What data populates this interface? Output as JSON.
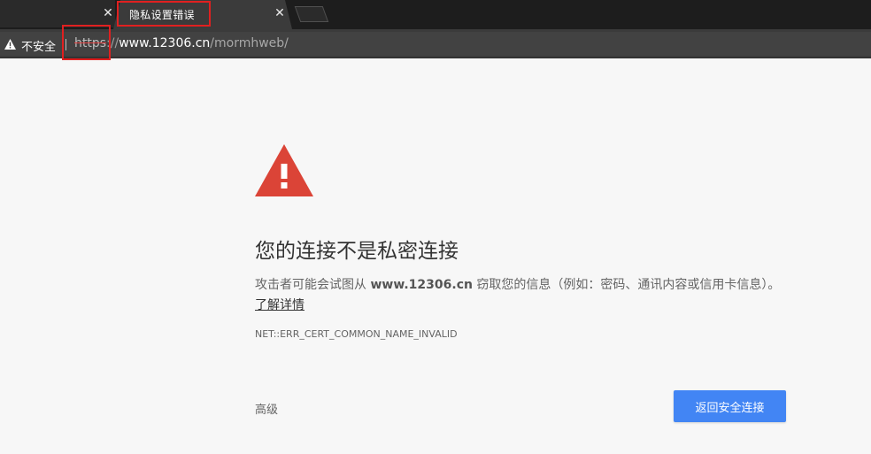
{
  "browser": {
    "tabs": [
      {
        "title": "",
        "active": false
      },
      {
        "title": "隐私设置错误",
        "active": true
      }
    ],
    "tab_close_glyph": "✕",
    "address_bar": {
      "security_label": "不安全",
      "scheme": "https",
      "separator": "://",
      "host": "www.12306.cn",
      "path": "/mormhweb/"
    }
  },
  "page": {
    "heading": "您的连接不是私密连接",
    "description": {
      "prefix": "攻击者可能会试图从 ",
      "host": "www.12306.cn",
      "suffix": " 窃取您的信息（例如：密码、通讯内容或信用卡信息）。",
      "learn_more": "了解详情"
    },
    "error_code": "NET::ERR_CERT_COMMON_NAME_INVALID",
    "advanced_label": "高级",
    "back_button_label": "返回安全连接"
  },
  "colors": {
    "warning_red": "#db4437",
    "primary_blue": "#4285f4",
    "highlight_box": "#e02020"
  },
  "icons": {
    "address_warning": "warning-triangle-icon",
    "page_warning": "warning-triangle-icon"
  }
}
